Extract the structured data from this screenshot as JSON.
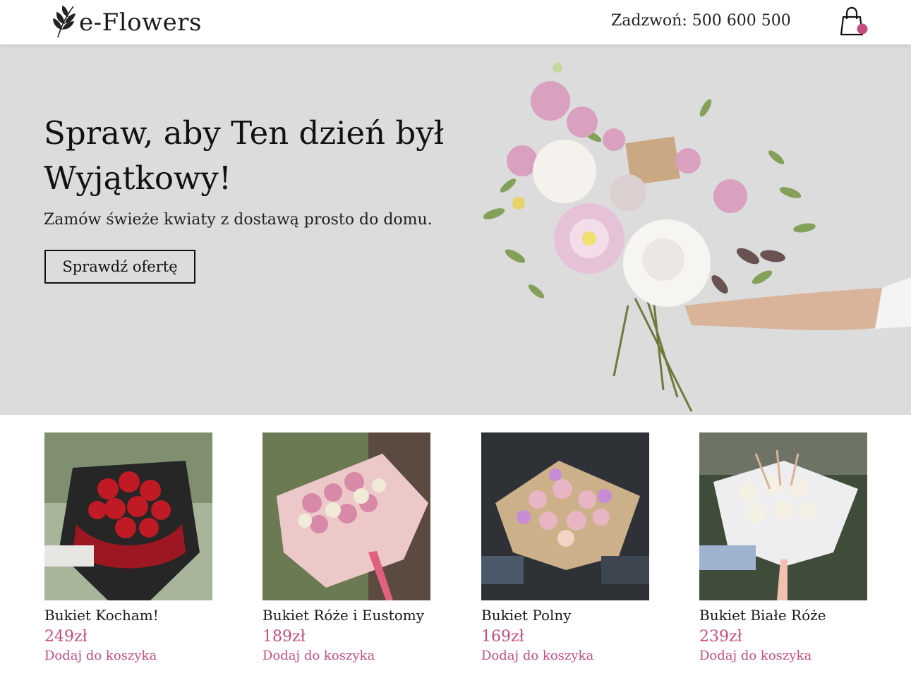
{
  "header": {
    "logo_text": "e-Flowers",
    "phone": "Zadzwoń: 500 600 500"
  },
  "hero": {
    "title": "Spraw, aby Ten dzień był Wyjątkowy!",
    "subtitle": "Zamów świeże kwiaty z dostawą prosto do domu.",
    "button_label": "Sprawdź ofertę"
  },
  "products": [
    {
      "name": "Bukiet Kocham!",
      "price": "249zł",
      "add_label": "Dodaj do koszyka"
    },
    {
      "name": "Bukiet Róże i Eustomy",
      "price": "189zł",
      "add_label": "Dodaj do koszyka"
    },
    {
      "name": "Bukiet Polny",
      "price": "169zł",
      "add_label": "Dodaj do koszyka"
    },
    {
      "name": "Bukiet Białe Róże",
      "price": "239zł",
      "add_label": "Dodaj do koszyka"
    }
  ],
  "colors": {
    "accent": "#c44d7e",
    "hero_bg": "#dcdcdc"
  },
  "icons": {
    "logo": "plant-sprig-icon",
    "cart": "shopping-bag-icon"
  }
}
